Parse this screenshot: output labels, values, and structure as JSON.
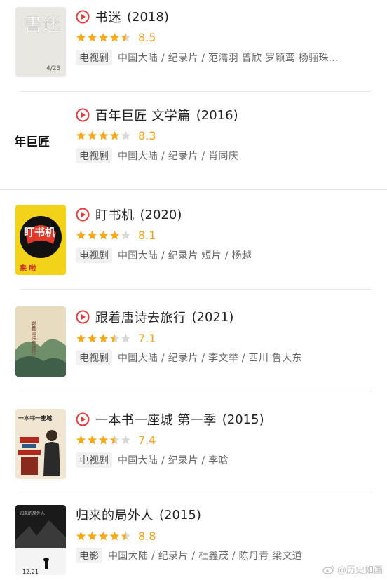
{
  "items": [
    {
      "title": "书迷",
      "year": "(2018)",
      "rating": 4.5,
      "score": "8.5",
      "tag": "电视剧",
      "meta": "中国大陆 / 纪录片 / 范濡羽 曾欣 罗颖鸾 杨骊珠...",
      "has_play": true,
      "poster_text": "書迷",
      "poster_sub": "4/23"
    },
    {
      "title": "百年巨匠 文学篇",
      "year": "(2016)",
      "rating": 4,
      "score": "8.3",
      "tag": "电视剧",
      "meta": "中国大陆 / 纪录片 / 肖同庆",
      "has_play": true,
      "poster_text": "年巨匠"
    },
    {
      "title": "盯书机",
      "year": "(2020)",
      "rating": 4,
      "score": "8.1",
      "tag": "电视剧",
      "meta": "中国大陆 / 纪录片 短片 / 杨越",
      "has_play": true,
      "poster_text": "盯书机",
      "poster_sub": "来 啦"
    },
    {
      "title": "跟着唐诗去旅行",
      "year": "(2021)",
      "rating": 3.5,
      "score": "7.1",
      "tag": "电视剧",
      "meta": "中国大陆 / 纪录片 / 李文举 / 西川 鲁大东",
      "has_play": true,
      "poster_text": "跟着唐诗去旅行"
    },
    {
      "title": "一本书一座城 第一季",
      "year": "(2015)",
      "rating": 3.5,
      "score": "7.4",
      "tag": "电视剧",
      "meta": "中国大陆 / 纪录片 / 李晗",
      "has_play": true,
      "poster_text": "一本书一座城"
    },
    {
      "title": "归来的局外人",
      "year": "(2015)",
      "rating": 4.5,
      "score": "8.8",
      "tag": "电影",
      "meta": "中国大陆 / 纪录片 / 杜鑫茂 / 陈丹青 梁文道",
      "has_play": false,
      "poster_text": "归来的局外人",
      "poster_sub": "12.21"
    }
  ],
  "watermark": "@历史如画",
  "colors": {
    "star": "#f7a81b",
    "star_empty": "#d8d8d8",
    "play": "#e33b3b",
    "score": "#f0a020"
  }
}
